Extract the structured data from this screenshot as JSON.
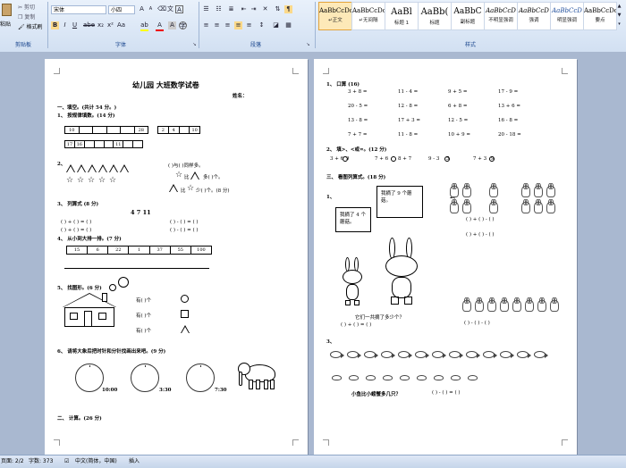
{
  "ribbon": {
    "clipboard": {
      "paste_label": "粘贴",
      "cut_label": "剪切",
      "copy_label": "复制",
      "format_painter_label": "格式刷",
      "group_label": "剪贴板"
    },
    "font": {
      "font_name": "宋体",
      "font_size": "小四",
      "group_label": "字体"
    },
    "paragraph": {
      "group_label": "段落"
    },
    "styles": {
      "group_label": "样式",
      "items": [
        {
          "preview": "AaBbCcDc",
          "name": "↵正文"
        },
        {
          "preview": "AaBbCcDc",
          "name": "↵无间隔"
        },
        {
          "preview": "AaBl",
          "name": "标题 1"
        },
        {
          "preview": "AaBb(",
          "name": "标题"
        },
        {
          "preview": "AaBbC",
          "name": "副标题"
        },
        {
          "preview": "AaBbCcD",
          "name": "不明显强调"
        },
        {
          "preview": "AaBbCcD",
          "name": "强调"
        },
        {
          "preview": "AaBbCcD",
          "name": "明显强调"
        },
        {
          "preview": "AaBbCcDc",
          "name": "要点"
        }
      ]
    }
  },
  "doc_left": {
    "title": "幼儿园 大班数学试卷",
    "name_label": "姓名：",
    "sec1": "一、填空。(共计 54 分。)",
    "q1": "1、 按规律填数。(14 分)",
    "seq1": [
      "10",
      "",
      "",
      "",
      "",
      "28"
    ],
    "seq2": [
      "2",
      "4",
      "",
      "10"
    ],
    "seq3": [
      "17",
      "16",
      "",
      "",
      "",
      "11",
      "",
      ""
    ],
    "q2": "2、",
    "q2_same": "(    )与(    )同样多。",
    "q2_more": "比",
    "q2_more2": "多(    )个。",
    "q2_less": "比",
    "q2_less2": "少(    )个。(8 分)",
    "q3": "3、 列算式 (8 分)",
    "q3_nums": "4    7    11",
    "q3_eq1": "(    ) + (    ) = (    )",
    "q3_eq2": "(    ) + (    ) = (    )",
    "q3_eq3": "(    ) - (    ) = (    )",
    "q3_eq4": "(    ) - (    ) = (    )",
    "q4": "4、 从小到大排一排。(7 分)",
    "q4_nums": [
      "15",
      "6",
      "22",
      "1",
      "37",
      "55",
      "100"
    ],
    "q5": "5、 找图形。(6 分)",
    "q5_rows": [
      "有(       )个",
      "有(       )个",
      "有(       )个"
    ],
    "q6": "6、 请将大象后把时针和分针找画出来吧。(9 分)",
    "times": [
      "10:00",
      "3:30",
      "7:30"
    ],
    "sec2": "二、 计算。(26 分)"
  },
  "doc_right": {
    "q1": "1、 口算 (16)",
    "calc": [
      [
        "3 + 8 =",
        "11 - 4 =",
        "9 + 5 =",
        "17 - 9 ="
      ],
      [
        "20 - 5 =",
        "12 - 8 =",
        "6 + 8 =",
        "13 + 6 ="
      ],
      [
        "13 - 8 =",
        "17 + 3 =",
        "12 - 5 =",
        "16 - 8 ="
      ],
      [
        "7 + 7 =",
        "11 - 8 =",
        "10 + 9 =",
        "20 - 18 ="
      ]
    ],
    "q2": "2、 填>、<或=。(12 分)",
    "compare": [
      "3 + 6",
      "9",
      "7 + 6",
      "8 + 7",
      "9 - 3",
      "5",
      "7 + 3",
      "9"
    ],
    "sec3": "三、 看图列算式。(18 分)",
    "p1": "1、",
    "p2": "2、",
    "bubble1": "我摘了 4 个蘑菇。",
    "bubble2": "我摘了 9 个蘑菇。",
    "caption": "它们一共摘了多少个？",
    "caption_eq": "(    ) + (    ) = (    )",
    "eq_a": "(    ) + (    ) - (    )",
    "eq_b": "(    ) + (    ) - (    )",
    "eq_c": "(    ) - (    ) - (    )",
    "p3": "3、",
    "fish_q": "小鱼比小螃蟹多几只？",
    "fish_eq": "(    ) - (    ) = (    )"
  },
  "status": {
    "page": "页面: 2/2",
    "words": "字数: 373",
    "lang": "中文(简体，中国)",
    "mode": "插入"
  }
}
